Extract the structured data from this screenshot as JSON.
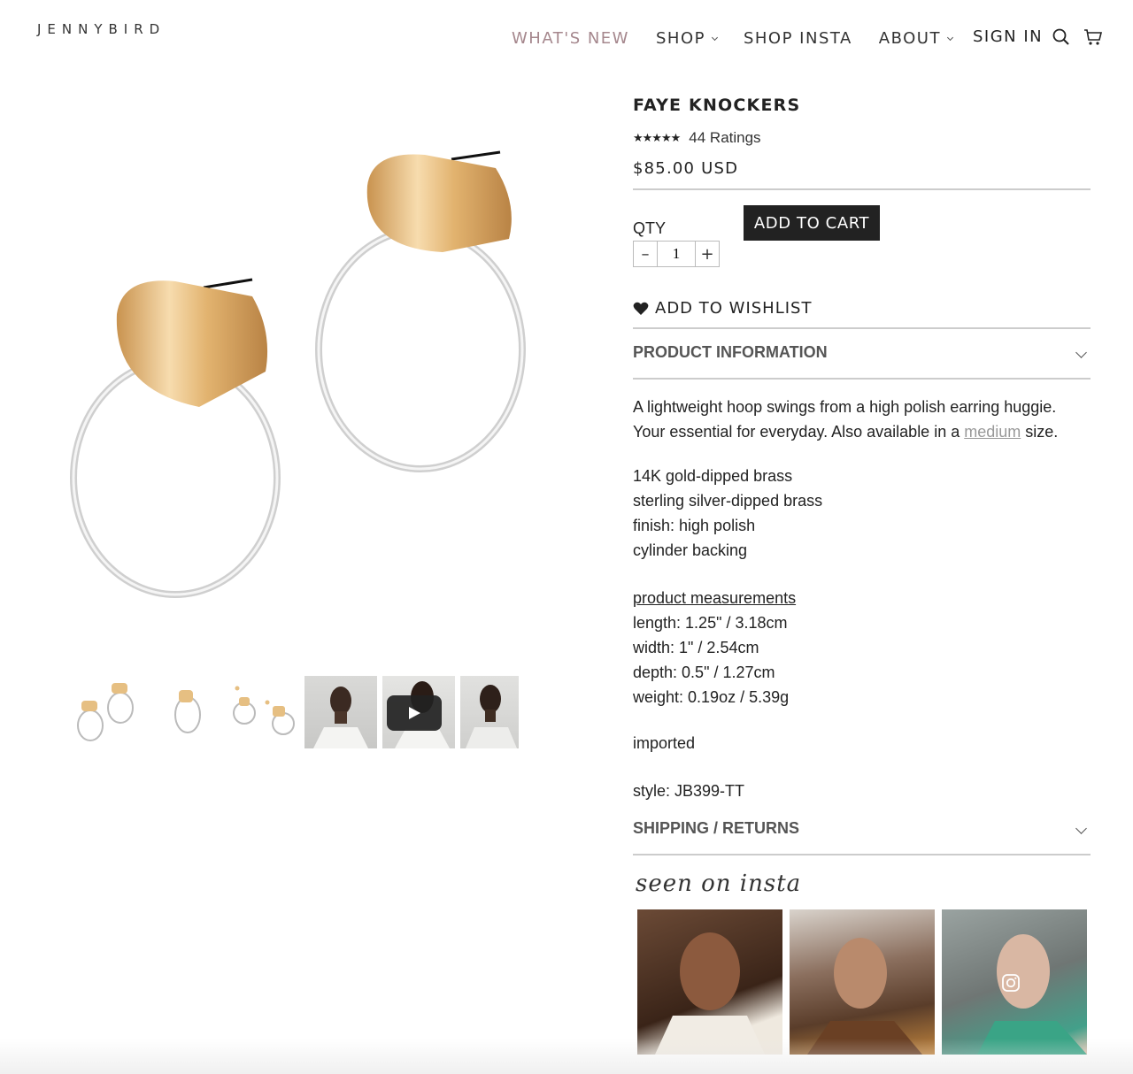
{
  "header": {
    "logo": "JENNYBIRD",
    "nav": [
      {
        "label": "WHAT'S NEW"
      },
      {
        "label": "SHOP"
      },
      {
        "label": "SHOP INSTA"
      },
      {
        "label": "ABOUT"
      }
    ],
    "sign_in": "SIGN IN",
    "icons": [
      "search-icon",
      "cart-icon"
    ],
    "accent_color": "#a5878d"
  },
  "product": {
    "title": "FAYE KNOCKERS",
    "stars": "★★★★★",
    "ratings": "44 Ratings",
    "price": "$85.00 USD",
    "qty_label": "QTY",
    "qty_value": "1",
    "qty_minus": "–",
    "qty_plus": "+",
    "add_to_cart": "ADD TO CART",
    "wishlist": "ADD TO WISHLIST"
  },
  "accordion": {
    "product_info": "PRODUCT INFORMATION",
    "shipping": "SHIPPING / RETURNS"
  },
  "description": {
    "text_before": "A lightweight hoop swings from a high polish earring huggie. Your essential for everyday. Also available in a ",
    "link": "medium",
    "text_after": " size.",
    "features": [
      "14K gold-dipped brass",
      "sterling silver-dipped brass",
      "finish: high polish",
      "cylinder backing"
    ],
    "measurements_link": "product measurements",
    "measurements": [
      "length: 1.25\" / 3.18cm",
      "width: 1\" / 2.54cm",
      "depth: 0.5\" / 1.27cm",
      "weight: 0.19oz / 5.39g"
    ],
    "origin": "imported",
    "style": "style: JB399-TT"
  },
  "insta": {
    "title": "seen on insta"
  }
}
